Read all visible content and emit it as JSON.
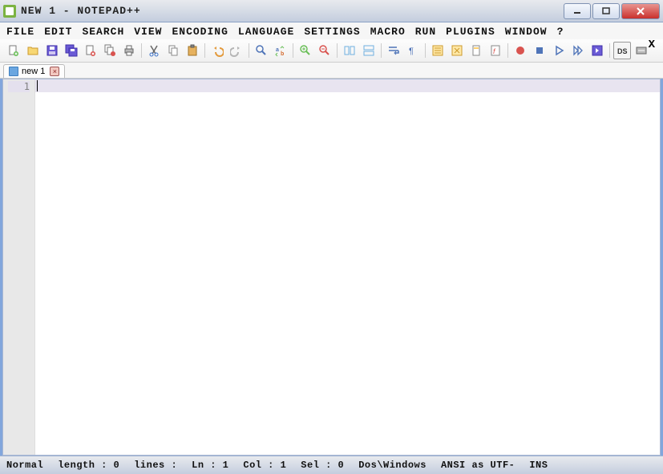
{
  "window": {
    "title": "new 1 - Notepad++"
  },
  "menu": [
    "File",
    "Edit",
    "Search",
    "View",
    "Encoding",
    "Language",
    "Settings",
    "Macro",
    "Run",
    "Plugins",
    "Window",
    "?"
  ],
  "tabs": [
    {
      "label": "new 1"
    }
  ],
  "editor": {
    "lines": [
      "1"
    ]
  },
  "status": {
    "filetype": "Normal",
    "length_label": "length :",
    "length": "0",
    "lines_label": "lines :",
    "ln_label": "Ln :",
    "ln": "1",
    "col_label": "Col :",
    "col": "1",
    "sel_label": "Sel :",
    "sel": "0",
    "eol": "Dos\\Windows",
    "encoding": "ANSI as UTF-",
    "ins": "INS"
  }
}
